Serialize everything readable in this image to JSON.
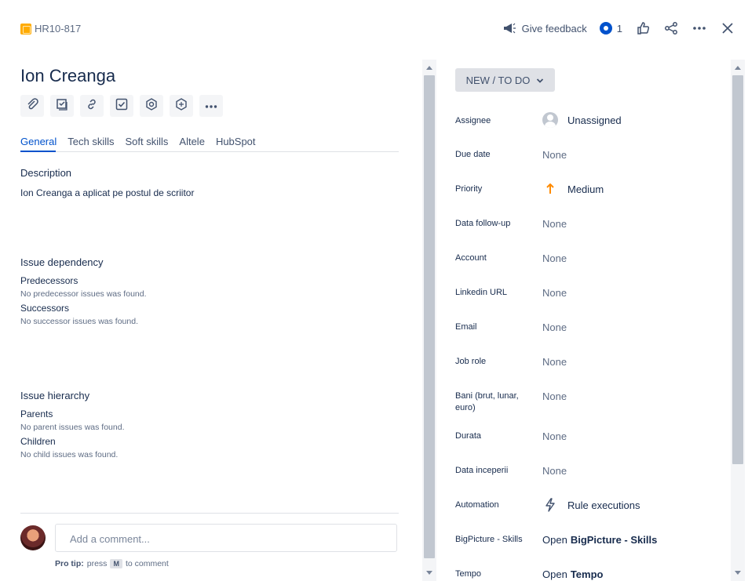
{
  "header": {
    "issue_key": "HR10-817",
    "give_feedback": "Give feedback",
    "watchers_count": "1",
    "icons": [
      "megaphone-icon",
      "eye-icon",
      "thumbs-up-icon",
      "share-icon",
      "more-icon",
      "close-icon"
    ]
  },
  "issue": {
    "title": "Ion Creanga",
    "toolbar_icons": [
      "paperclip-icon",
      "checklist-icon",
      "link-icon",
      "checkbox-icon",
      "app-icon",
      "app-icon",
      "more-icon"
    ],
    "tabs": [
      "General",
      "Tech skills",
      "Soft skills",
      "Altele",
      "HubSpot"
    ],
    "active_tab": "General",
    "description": {
      "label": "Description",
      "text": "Ion Creanga a aplicat pe postul de scriitor"
    },
    "dependency": {
      "label": "Issue dependency",
      "predecessors_label": "Predecessors",
      "predecessors_empty": "No predecessor issues was found.",
      "successors_label": "Successors",
      "successors_empty": "No successor issues was found."
    },
    "hierarchy": {
      "label": "Issue hierarchy",
      "parents_label": "Parents",
      "parents_empty": "No parent issues was found.",
      "children_label": "Children",
      "children_empty": "No child issues was found."
    }
  },
  "comment": {
    "placeholder": "Add a comment...",
    "protip_bold": "Pro tip:",
    "protip_press": "press",
    "protip_key": "M",
    "protip_rest": "to comment"
  },
  "sidebar": {
    "status": "NEW / TO DO",
    "fields": [
      {
        "label": "Assignee",
        "value": "Unassigned"
      },
      {
        "label": "Due date",
        "value": "None"
      },
      {
        "label": "Priority",
        "value": "Medium"
      },
      {
        "label": "Data follow-up",
        "value": "None"
      },
      {
        "label": "Account",
        "value": "None"
      },
      {
        "label": "Linkedin URL",
        "value": "None"
      },
      {
        "label": "Email",
        "value": "None"
      },
      {
        "label": "Job role",
        "value": "None"
      },
      {
        "label": "Bani (brut, lunar, euro)",
        "value": "None"
      },
      {
        "label": "Durata",
        "value": "None"
      },
      {
        "label": "Data inceperii",
        "value": "None"
      },
      {
        "label": "Automation",
        "value": "Rule executions"
      },
      {
        "label": "BigPicture - Skills",
        "value_prefix": "Open",
        "value_strong": "BigPicture - Skills"
      },
      {
        "label": "Tempo",
        "value_prefix": "Open",
        "value_strong": "Tempo"
      }
    ]
  },
  "colors": {
    "accent": "#0052cc",
    "priority_medium": "#ff8b00",
    "issue_type": "#ffab00"
  }
}
